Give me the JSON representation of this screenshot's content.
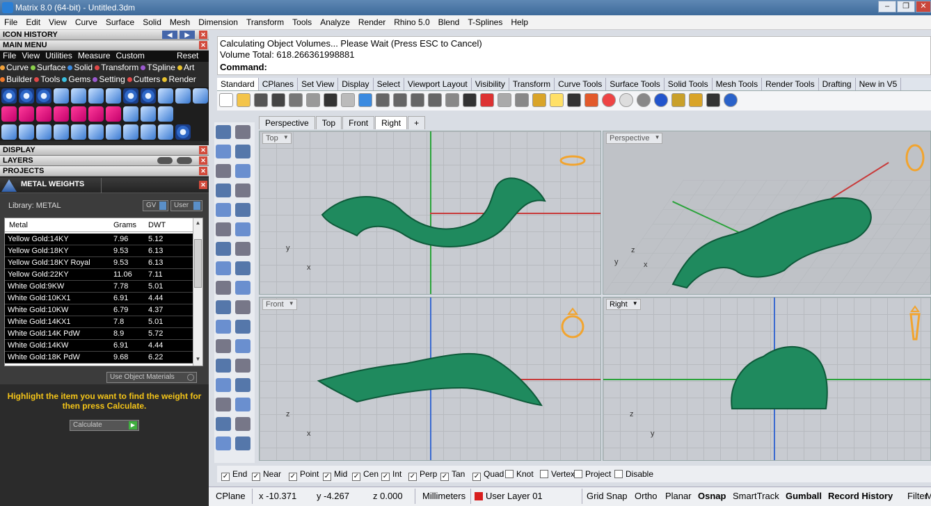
{
  "titlebar": {
    "title": "Matrix 8.0 (64-bit) - Untitled.3dm",
    "min": "‒",
    "max": "❐",
    "close": "✕"
  },
  "menu": [
    "File",
    "Edit",
    "View",
    "Curve",
    "Surface",
    "Solid",
    "Mesh",
    "Dimension",
    "Transform",
    "Tools",
    "Analyze",
    "Render",
    "Rhino 5.0",
    "Blend",
    "T-Splines",
    "Help"
  ],
  "panel": {
    "icon_history": "ICON HISTORY",
    "main_menu": "MAIN MENU",
    "submenu": [
      "File",
      "View",
      "Utilities",
      "Measure",
      "Custom"
    ],
    "reset": "Reset",
    "row1": [
      {
        "label": "Curve",
        "color": "#f2a23a"
      },
      {
        "label": "Surface",
        "color": "#8bd04b"
      },
      {
        "label": "Solid",
        "color": "#3a8ae0"
      },
      {
        "label": "Transform",
        "color": "#e04848"
      },
      {
        "label": "TSpline",
        "color": "#9b59d0"
      },
      {
        "label": "Art",
        "color": "#e8c22e"
      }
    ],
    "row2": [
      {
        "label": "Builder",
        "color": "#f27a2a"
      },
      {
        "label": "Tools",
        "color": "#e04848"
      },
      {
        "label": "Gems",
        "color": "#3ac0e0"
      },
      {
        "label": "Setting",
        "color": "#9b59d0"
      },
      {
        "label": "Cutters",
        "color": "#e04848"
      },
      {
        "label": "Render",
        "color": "#e8c22e"
      }
    ],
    "display": "DISPLAY",
    "layers": "LAYERS",
    "projects": "PROJECTS",
    "metal_weights": "METAL WEIGHTS",
    "library": "Library: METAL",
    "gv": "GV",
    "user": "User",
    "table": {
      "headers": [
        "Metal",
        "Grams",
        "DWT"
      ],
      "rows": [
        [
          "Yellow Gold:14KY",
          "7.96",
          "5.12"
        ],
        [
          "Yellow Gold:18KY",
          "9.53",
          "6.13"
        ],
        [
          "Yellow Gold:18KY Royal",
          "9.53",
          "6.13"
        ],
        [
          "Yellow Gold:22KY",
          "11.06",
          "7.11"
        ],
        [
          "White Gold:9KW",
          "7.78",
          "5.01"
        ],
        [
          "White Gold:10KX1",
          "6.91",
          "4.44"
        ],
        [
          "White Gold:10KW",
          "6.79",
          "4.37"
        ],
        [
          "White Gold:14KX1",
          "7.8",
          "5.01"
        ],
        [
          "White Gold:14K PdW",
          "8.9",
          "5.72"
        ],
        [
          "White Gold:14KW",
          "6.91",
          "4.44"
        ],
        [
          "White Gold:18K PdW",
          "9.68",
          "6.22"
        ]
      ]
    },
    "use_object_materials": "Use Object Materials",
    "hint": "Highlight the item you want to find the weight for then press Calculate.",
    "calculate": "Calculate"
  },
  "command": {
    "line1": "Calculating Object Volumes... Please Wait (Press ESC to Cancel)",
    "line2": "Volume Total: 618.266361998881",
    "prompt": "Command:"
  },
  "tabs": [
    "Standard",
    "CPlanes",
    "Set View",
    "Display",
    "Select",
    "Viewport Layout",
    "Visibility",
    "Transform",
    "Curve Tools",
    "Surface Tools",
    "Solid Tools",
    "Mesh Tools",
    "Render Tools",
    "Drafting",
    "New in V5"
  ],
  "viewport_tabs": [
    "Perspective",
    "Top",
    "Front",
    "Right",
    "+"
  ],
  "viewports": {
    "top": {
      "title": "Top",
      "ax1": "y",
      "ax2": "x"
    },
    "perspective": {
      "title": "Perspective",
      "ax1": "z",
      "ax2": "y",
      "ax3": "x"
    },
    "front": {
      "title": "Front",
      "ax1": "z",
      "ax2": "x"
    },
    "right": {
      "title": "Right",
      "ax1": "z",
      "ax2": "y"
    }
  },
  "osnap": [
    {
      "label": "End",
      "checked": true
    },
    {
      "label": "Near",
      "checked": true
    },
    {
      "label": "Point",
      "checked": true
    },
    {
      "label": "Mid",
      "checked": true
    },
    {
      "label": "Cen",
      "checked": true
    },
    {
      "label": "Int",
      "checked": true
    },
    {
      "label": "Perp",
      "checked": true
    },
    {
      "label": "Tan",
      "checked": true
    },
    {
      "label": "Quad",
      "checked": true
    },
    {
      "label": "Knot",
      "checked": false
    },
    {
      "label": "Vertex",
      "checked": false
    },
    {
      "label": "Project",
      "checked": false
    },
    {
      "label": "Disable",
      "checked": false
    }
  ],
  "status": {
    "cplane": "CPlane",
    "x": "x -10.371",
    "y": "y -4.267",
    "z": "z 0.000",
    "units": "Millimeters",
    "layer": "User Layer 01",
    "layer_color": "#d81e1e",
    "grid_snap": "Grid Snap",
    "ortho": "Ortho",
    "planar": "Planar",
    "osnap": "Osnap",
    "smarttrack": "SmartTrack",
    "gumball": "Gumball",
    "record_history": "Record History",
    "filter": "Filter",
    "m": "M"
  },
  "colors": {
    "model": "#1f8a5e",
    "model_dark": "#0e5a3a",
    "ring": "#f2a42e"
  }
}
